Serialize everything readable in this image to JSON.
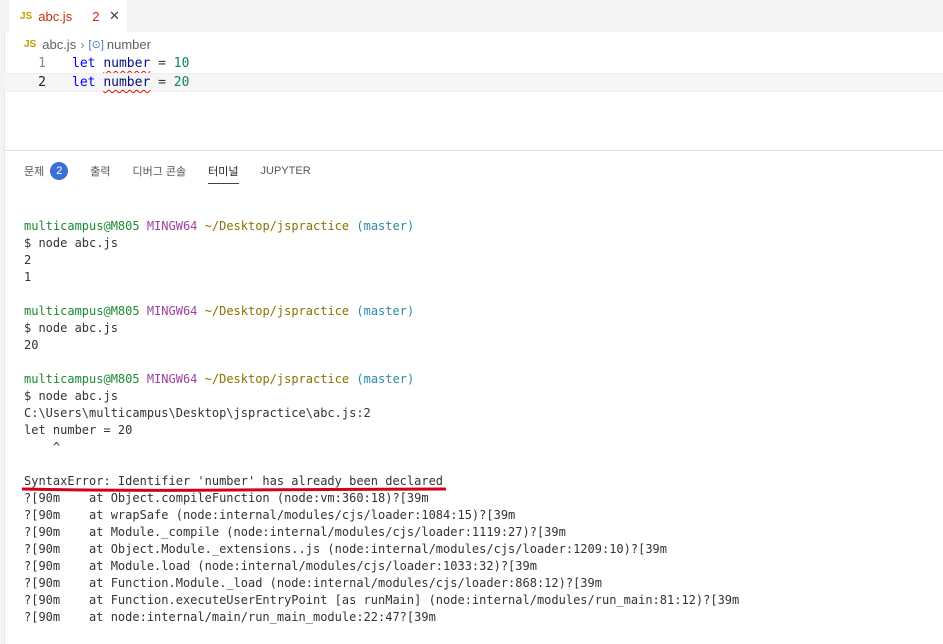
{
  "tab": {
    "lang": "JS",
    "filename": "abc.js",
    "problems": "2",
    "close": "✕"
  },
  "breadcrumb": {
    "lang": "JS",
    "file": "abc.js",
    "sep": "›",
    "symbol_icon": "[⊙]",
    "symbol": "number"
  },
  "editor": {
    "lines": [
      {
        "num": "1",
        "kw": "let",
        "var": "number",
        "op": " = ",
        "val": "10"
      },
      {
        "num": "2",
        "kw": "let",
        "var": "number",
        "op": " = ",
        "val": "20"
      }
    ]
  },
  "panel": {
    "tabs": [
      {
        "label": "문제"
      },
      {
        "label": "출력"
      },
      {
        "label": "디버그 콘솔"
      },
      {
        "label": "터미널"
      },
      {
        "label": "JUPYTER"
      }
    ],
    "problems_badge": "2"
  },
  "terminal": {
    "prompt": {
      "user": "multicampus@M805",
      "sys": "MINGW64",
      "path": "~/Desktop/jspractice",
      "branch": "(master)"
    },
    "cmd": "$ node abc.js",
    "run1": [
      "2",
      "1"
    ],
    "run2": [
      "20"
    ],
    "run3": [
      "C:\\Users\\multicampus\\Desktop\\jspractice\\abc.js:2",
      "let number = 20",
      "    ^",
      "",
      "SyntaxError: Identifier 'number' has already been declared",
      "?[90m    at Object.compileFunction (node:vm:360:18)?[39m",
      "?[90m    at wrapSafe (node:internal/modules/cjs/loader:1084:15)?[39m",
      "?[90m    at Module._compile (node:internal/modules/cjs/loader:1119:27)?[39m",
      "?[90m    at Object.Module._extensions..js (node:internal/modules/cjs/loader:1209:10)?[39m",
      "?[90m    at Module.load (node:internal/modules/cjs/loader:1033:32)?[39m",
      "?[90m    at Function.Module._load (node:internal/modules/cjs/loader:868:12)?[39m",
      "?[90m    at Function.executeUserEntryPoint [as runMain] (node:internal/modules/run_main:81:12)?[39m",
      "?[90m    at node:internal/main/run_main_module:22:47?[39m"
    ]
  },
  "colors": {
    "error_underline": "#d4001a",
    "badge": "#3b6fd6"
  }
}
